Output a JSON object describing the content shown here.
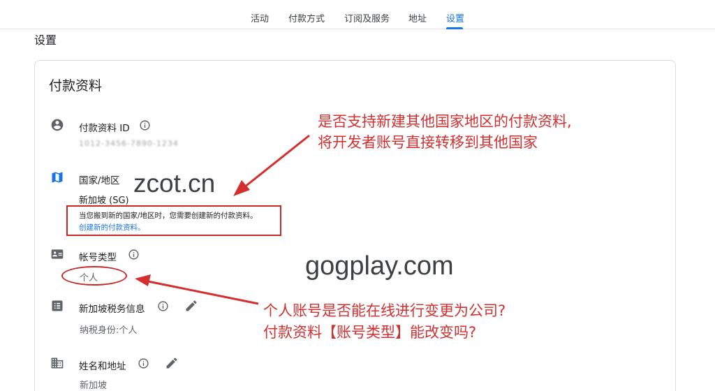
{
  "nav": {
    "tabs": [
      {
        "label": "活动"
      },
      {
        "label": "付款方式"
      },
      {
        "label": "订阅及服务"
      },
      {
        "label": "地址"
      },
      {
        "label": "设置"
      }
    ],
    "active_index": 4
  },
  "page": {
    "title": "设置"
  },
  "card": {
    "title": "付款资料",
    "profile_id": {
      "label": "付款资料 ID",
      "value": "1012-3456-7890-1234"
    },
    "country": {
      "label": "国家/地区",
      "value": "新加坡 (SG)",
      "note": "当您搬到新的国家/地区时，您需要创建新的付款资料。",
      "note_link": "创建新的付款资料。"
    },
    "account_type": {
      "label": "帐号类型",
      "value": "个人"
    },
    "tax_info": {
      "label": "新加坡税务信息",
      "value": "纳税身份:个人"
    },
    "name_address": {
      "label": "姓名和地址",
      "value": "新加坡"
    }
  },
  "watermarks": {
    "primary": "zcot.cn",
    "secondary": "gogplay.com"
  },
  "annotations": {
    "top_line1": "是否支持新建其他国家地区的付款资料,",
    "top_line2": "将开发者账号直接转移到其他国家",
    "bottom_line1": "个人账号是否能在线进行变更为公司?",
    "bottom_line2": "付款资料【账号类型】能改变吗?"
  },
  "colors": {
    "accent": "#1a73e8",
    "annotation": "#d32f2f",
    "icon": "#5f6368",
    "map_icon": "#1a73e8"
  }
}
